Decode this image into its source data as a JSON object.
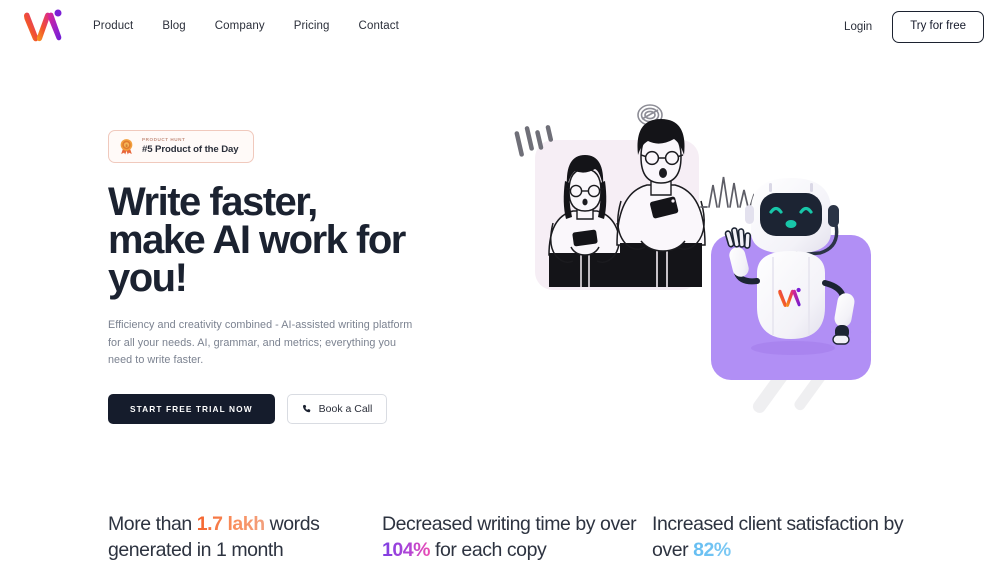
{
  "nav": {
    "logo_name": "writeai-logo",
    "links": [
      {
        "label": "Product"
      },
      {
        "label": "Blog"
      },
      {
        "label": "Company"
      },
      {
        "label": "Pricing"
      },
      {
        "label": "Contact"
      }
    ],
    "login_label": "Login",
    "cta_label": "Try for free"
  },
  "hero": {
    "badge": {
      "icon": "medal-icon",
      "kicker": "PRODUCT HUNT",
      "title": "#5 Product of the Day"
    },
    "title": "Write faster, make AI work for you!",
    "subtitle": "Efficiency and creativity combined - AI-assisted writing platform for all your needs. AI, grammar, and metrics; everything you need to write faster.",
    "primary_cta": "START FREE TRIAL NOW",
    "secondary_cta": "Book a Call",
    "secondary_cta_icon": "phone-icon",
    "illustration": {
      "name": "people-and-robot-illustration",
      "people_panel_color": "#f6eef5",
      "robot_panel_color": "#b18ff5",
      "robot_face_color": "#1c2433",
      "robot_eye_color": "#18c7a9"
    }
  },
  "stats": [
    {
      "prefix": "More than ",
      "highlight": "1.7 lakh",
      "suffix": " words generated in 1 month",
      "highlight_color": "#f4622c"
    },
    {
      "prefix": "Decreased writing time by over ",
      "highlight": "104%",
      "suffix": " for each copy",
      "highlight_color": "#8b3fdf"
    },
    {
      "prefix": "Increased client satisfaction by over ",
      "highlight": "82%",
      "suffix": "",
      "highlight_color": "#63bdf2"
    }
  ],
  "colors": {
    "heading": "#1b2230",
    "body_text": "#7b8290",
    "dark_button": "#151c2c",
    "brand_purple": "#8b2fd6",
    "brand_orange": "#f7a01c"
  }
}
